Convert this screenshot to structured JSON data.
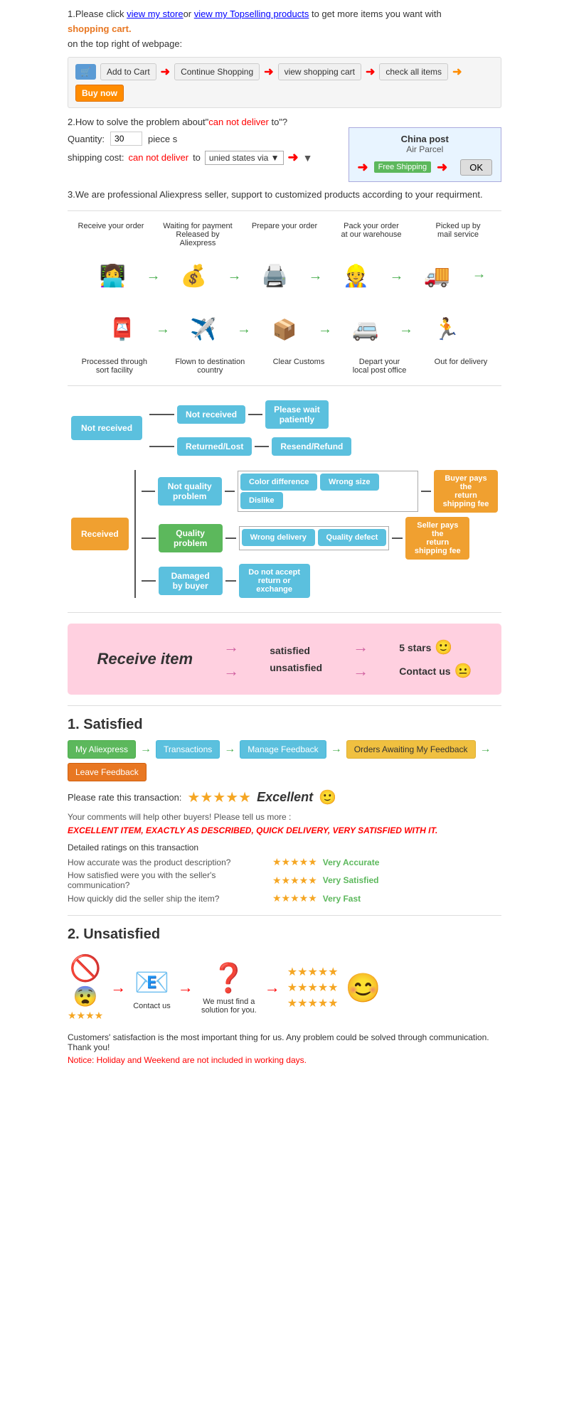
{
  "section1": {
    "text1": "1.Please click ",
    "link1": "view my store",
    "text2": "or ",
    "link2": "view my Topselling products",
    "text3": " to get more items you want with",
    "shopping_cart": "shopping cart.",
    "text4": "on the top right of webpage:",
    "add_to_cart": "Add to Cart",
    "continue_shopping": "Continue Shopping",
    "view_cart": "view shopping cart",
    "check_items": "check all items",
    "buy_now": "Buy now"
  },
  "section2": {
    "title": "2.How to solve the problem about\"can not deliver to\"?",
    "can_not": "can not deliver",
    "quantity_label": "Quantity:",
    "quantity_value": "30",
    "piece": "piece s",
    "shipping_label": "shipping cost:",
    "shipping_can_not": "can not deliver",
    "shipping_to": " to ",
    "shipping_via": "unied states via",
    "china_post_title": "China post",
    "air_parcel": "Air Parcel",
    "free_shipping": "Free Shipping",
    "ok": "OK"
  },
  "section3": {
    "text": "3.We are professional Aliexpress seller, support to customized products according to your requirment."
  },
  "process": {
    "top_labels": [
      "Receive your order",
      "Waiting for payment Released by Aliexpress",
      "Prepare your order",
      "Pack your order at our warehouse",
      "Picked up by mail service"
    ],
    "top_icons": [
      "👩‍💻",
      "💰",
      "🖨️",
      "👷",
      "🚛"
    ],
    "bottom_icons": [
      "🏃",
      "🚐",
      "📦",
      "✈️",
      "📮"
    ],
    "bottom_labels": [
      "Out for delivery",
      "Depart your local post office",
      "Clear Customs",
      "Flown to destination country",
      "Processed through sort facility"
    ]
  },
  "flowchart": {
    "not_received_main": "Not received",
    "not_received_sub1": "Not received",
    "not_received_sub2": "Returned/Lost",
    "please_wait": "Please wait patiently",
    "resend_refund": "Resend/Refund",
    "received_main": "Received",
    "not_quality": "Not quality problem",
    "quality_problem": "Quality problem",
    "damaged": "Damaged by buyer",
    "color_diff": "Color difference",
    "wrong_size": "Wrong size",
    "dislike": "Dislike",
    "wrong_delivery": "Wrong delivery",
    "quality_defect": "Quality defect",
    "do_not_accept": "Do not accept return or exchange",
    "buyer_pays": "Buyer pays the return shipping fee",
    "seller_pays": "Seller pays the return shipping fee"
  },
  "satisfaction": {
    "receive_item": "Receive item",
    "satisfied": "satisfied",
    "unsatisfied": "unsatisfied",
    "five_stars": "5 stars",
    "contact_us": "Contact us",
    "emoji_happy": "🙂",
    "emoji_neutral": "😐"
  },
  "satisfied_section": {
    "title": "1. Satisfied",
    "my_aliexpress": "My Aliexpress",
    "transactions": "Transactions",
    "manage_feedback": "Manage Feedback",
    "orders_awaiting": "Orders Awaiting My Feedback",
    "leave_feedback": "Leave Feedback",
    "rate_text": "Please rate this transaction:",
    "excellent": "Excellent",
    "emoji": "🙂",
    "comment_text": "Your comments will help other buyers! Please tell us more :",
    "review": "EXCELLENT ITEM, EXACTLY AS DESCRIBED, QUICK DELIVERY, VERY SATISFIED WITH IT.",
    "detailed_title": "Detailed ratings on this transaction",
    "rating1_label": "How accurate was the product description?",
    "rating1_text": "Very Accurate",
    "rating2_label": "How satisfied were you with the seller's communication?",
    "rating2_text": "Very Satisfied",
    "rating3_label": "How quickly did the seller ship the item?",
    "rating3_text": "Very Fast"
  },
  "unsatisfied_section": {
    "title": "2. Unsatisfied",
    "icons": [
      "🚫",
      "😨",
      "📧",
      "❓",
      "⭐"
    ],
    "contact_us": "Contact us",
    "solution_text": "We must find a solution for you.",
    "notice_text": "Customers' satisfaction is the most important thing for us. Any problem could be solved through communication. Thank you!",
    "notice_red": "Notice: Holiday and Weekend are not included in working days."
  },
  "colors": {
    "blue_box": "#5bc0de",
    "orange_box": "#f0a030",
    "green_box": "#5cb85c",
    "red": "#cc0000",
    "orange_link": "#e87722",
    "pink_bg": "#ffd0e0"
  }
}
